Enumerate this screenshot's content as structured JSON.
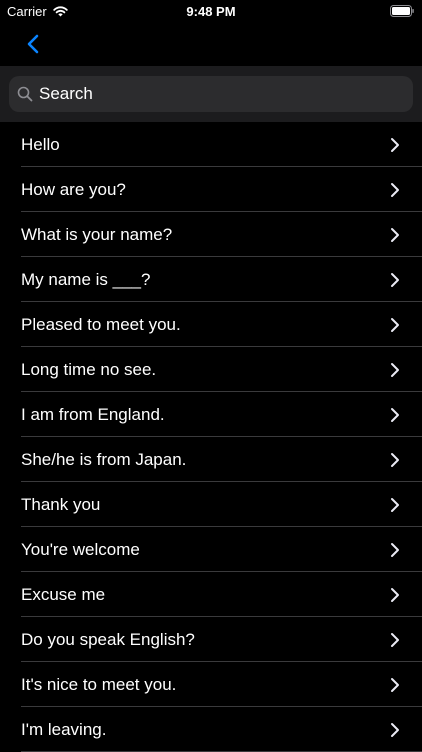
{
  "status_bar": {
    "carrier": "Carrier",
    "time": "9:48 PM"
  },
  "search": {
    "placeholder": "Search"
  },
  "colors": {
    "accent": "#0a84ff",
    "background": "#000000",
    "search_section_bg": "#1c1c1e",
    "search_field_bg": "#2c2c2e",
    "separator": "#3a3a3c",
    "chevron": "#ebebf5"
  },
  "phrases": [
    {
      "label": "Hello"
    },
    {
      "label": "How are you?"
    },
    {
      "label": "What is your name?"
    },
    {
      "label": "My name is ___?"
    },
    {
      "label": "Pleased to meet you."
    },
    {
      "label": "Long time no see."
    },
    {
      "label": "I am from England."
    },
    {
      "label": "She/he is from Japan."
    },
    {
      "label": "Thank you"
    },
    {
      "label": "You're welcome"
    },
    {
      "label": "Excuse me"
    },
    {
      "label": "Do you speak English?"
    },
    {
      "label": "It's nice to meet you."
    },
    {
      "label": "I'm leaving."
    }
  ]
}
